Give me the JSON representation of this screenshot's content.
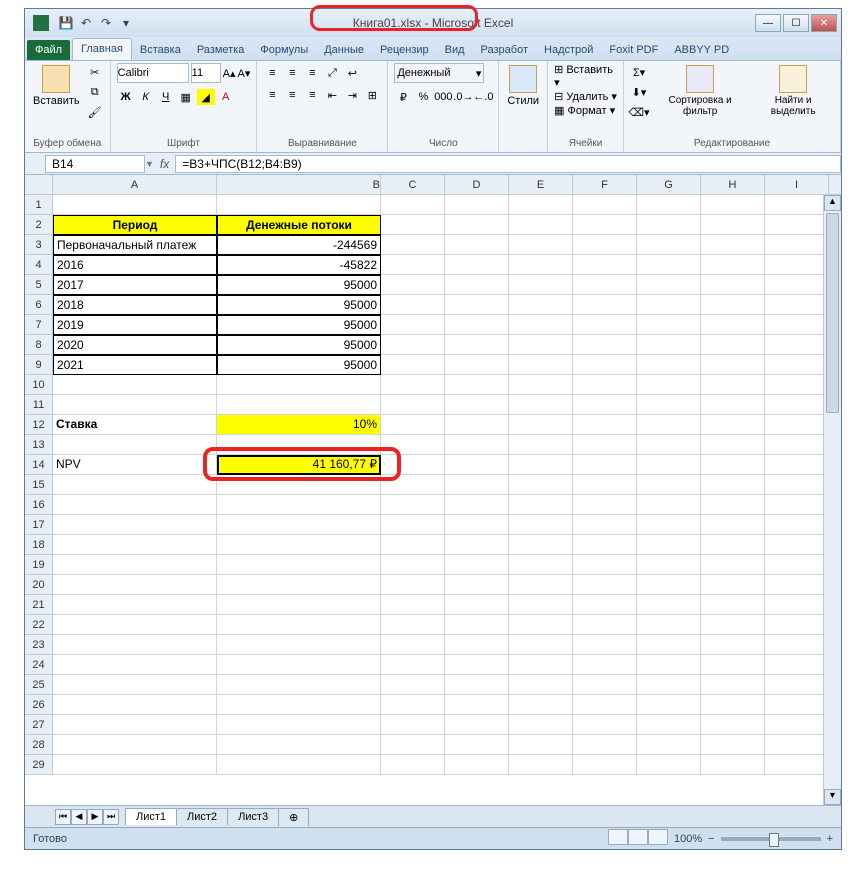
{
  "title": "Книга01.xlsx - Microsoft Excel",
  "tabs": {
    "file": "Файл",
    "home": "Главная",
    "insert": "Вставка",
    "layout": "Разметка",
    "formulas": "Формулы",
    "data": "Данные",
    "review": "Рецензир",
    "view": "Вид",
    "developer": "Разработ",
    "addins": "Надстрой",
    "foxit": "Foxit PDF",
    "abbyy": "ABBYY PD"
  },
  "ribbon": {
    "clipboard": {
      "paste": "Вставить",
      "label": "Буфер обмена"
    },
    "font": {
      "name": "Calibri",
      "size": "11",
      "label": "Шрифт"
    },
    "align": {
      "label": "Выравнивание"
    },
    "number": {
      "format": "Денежный",
      "label": "Число"
    },
    "styles": {
      "label": "Стили",
      "btn": "Стили"
    },
    "cells": {
      "insert": "Вставить",
      "delete": "Удалить",
      "format": "Формат",
      "label": "Ячейки"
    },
    "editing": {
      "sort": "Сортировка и фильтр",
      "find": "Найти и выделить",
      "label": "Редактирование"
    }
  },
  "namebox": "B14",
  "formula": "=B3+ЧПС(B12;B4:B9)",
  "columns": [
    "A",
    "B",
    "C",
    "D",
    "E",
    "F",
    "G",
    "H",
    "I"
  ],
  "cells": {
    "a2": "Период",
    "b2": "Денежные потоки",
    "a3": "Первоначальный платеж",
    "b3": "-244569",
    "a4": "2016",
    "b4": "-45822",
    "a5": "2017",
    "b5": "95000",
    "a6": "2018",
    "b6": "95000",
    "a7": "2019",
    "b7": "95000",
    "a8": "2020",
    "b8": "95000",
    "a9": "2021",
    "b9": "95000",
    "a12": "Ставка",
    "b12": "10%",
    "a14": "NPV",
    "b14": "41 160,77 ₽"
  },
  "sheets": {
    "s1": "Лист1",
    "s2": "Лист2",
    "s3": "Лист3"
  },
  "status": {
    "ready": "Готово",
    "zoom": "100%"
  }
}
